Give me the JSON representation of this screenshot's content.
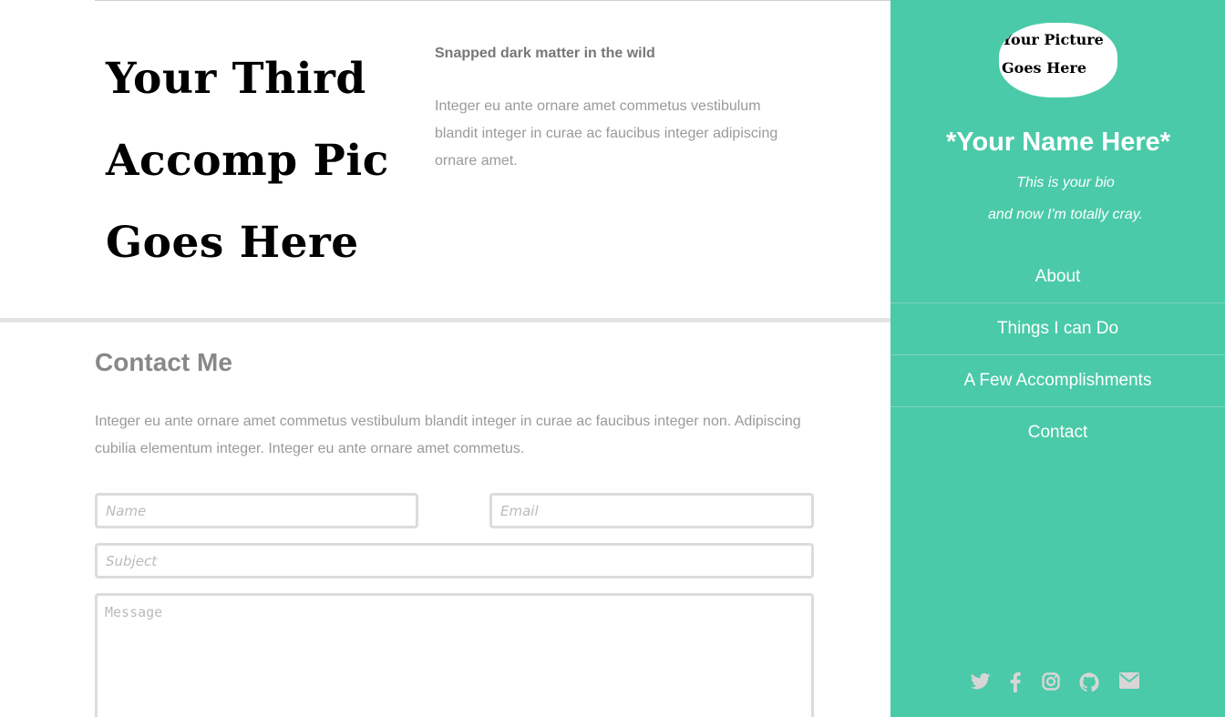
{
  "featured": {
    "picture_lines": [
      "Your Third",
      "Accomp Pic",
      "Goes Here"
    ],
    "title": "Snapped dark matter in the wild",
    "description": "Integer eu ante ornare amet commetus vestibulum blandit integer in curae ac faucibus integer adipiscing ornare amet."
  },
  "contact": {
    "title": "Contact Me",
    "description": "Integer eu ante ornare amet commetus vestibulum blandit integer in curae ac faucibus integer non. Adipiscing cubilia elementum integer. Integer eu ante ornare amet commetus.",
    "form": {
      "name_placeholder": "Name",
      "email_placeholder": "Email",
      "subject_placeholder": "Subject",
      "message_placeholder": "Message"
    }
  },
  "sidebar": {
    "avatar_lines": [
      "Your Picture",
      "Goes Here"
    ],
    "name": "*Your Name Here*",
    "bio_lines": [
      "This is your bio",
      "and now I'm totally cray."
    ],
    "nav": [
      {
        "label": "About"
      },
      {
        "label": "Things I can Do"
      },
      {
        "label": "A Few Accomplishments"
      },
      {
        "label": "Contact"
      }
    ],
    "social_icons": [
      "twitter-icon",
      "facebook-icon",
      "instagram-icon",
      "github-icon",
      "envelope-icon"
    ],
    "colors": {
      "background": "#4acaa8",
      "icon": "#d6d6d6",
      "text": "#ffffff"
    }
  }
}
